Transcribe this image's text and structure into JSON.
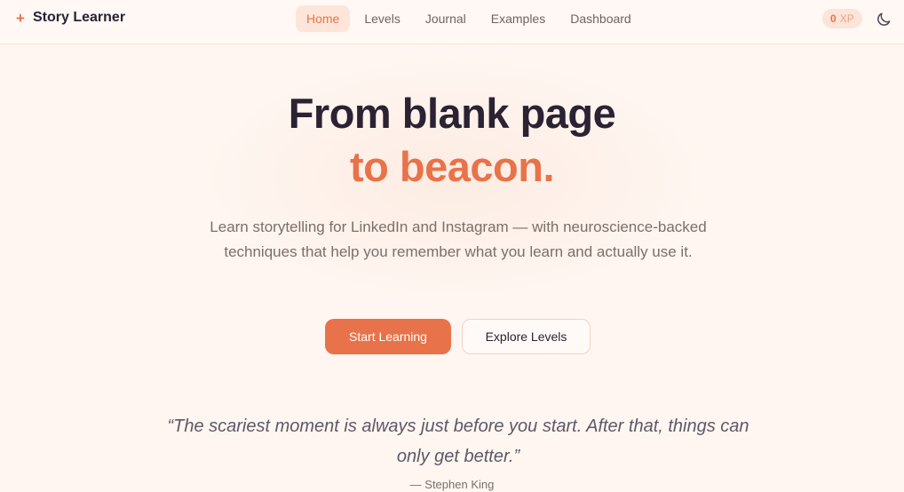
{
  "header": {
    "brand_icon": "+",
    "brand_name": "Story Learner",
    "nav": [
      {
        "label": "Home",
        "active": true
      },
      {
        "label": "Levels",
        "active": false
      },
      {
        "label": "Journal",
        "active": false
      },
      {
        "label": "Examples",
        "active": false
      },
      {
        "label": "Dashboard",
        "active": false
      }
    ],
    "xp": {
      "value": "0",
      "unit": "XP"
    },
    "theme_toggle_icon": "moon-icon"
  },
  "hero": {
    "title_line1": "From blank page",
    "title_line2": "to beacon.",
    "subtitle": "Learn storytelling for LinkedIn and Instagram — with neuroscience-backed techniques that help you remember what you learn and actually use it.",
    "primary_button": "Start Learning",
    "secondary_button": "Explore Levels"
  },
  "quote": {
    "text": "“The scariest moment is always just before you start. After that, things can only get better.”",
    "author": "— Stephen King"
  },
  "colors": {
    "accent": "#e8734a",
    "background": "#fff6f1",
    "text_dark": "#2b2233",
    "text_muted": "#7b6f6a"
  }
}
